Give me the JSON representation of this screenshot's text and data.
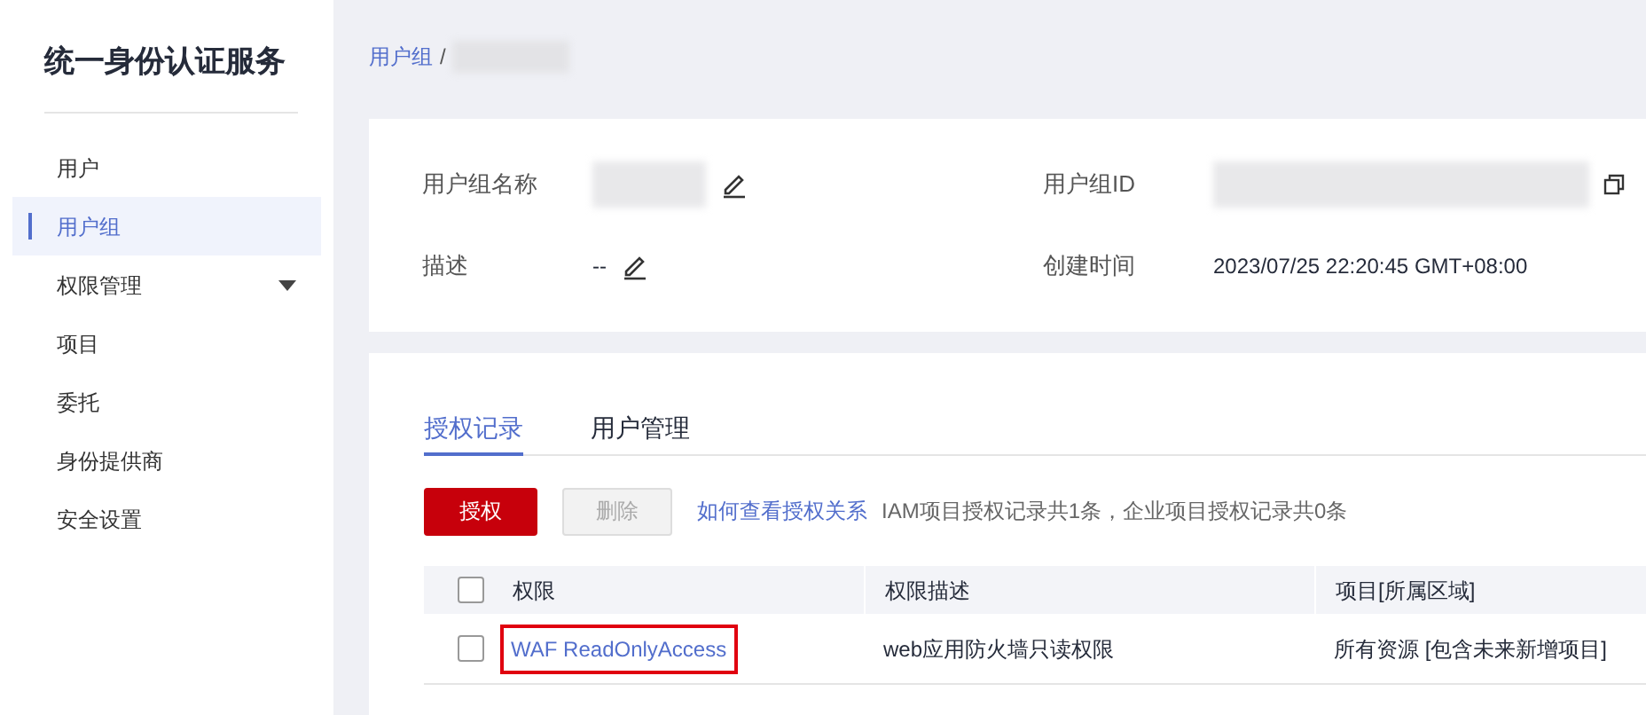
{
  "sidebar": {
    "title": "统一身份认证服务",
    "items": [
      {
        "label": "用户",
        "selected": false
      },
      {
        "label": "用户组",
        "selected": true
      },
      {
        "label": "权限管理",
        "selected": false,
        "expandable": true
      },
      {
        "label": "项目",
        "selected": false
      },
      {
        "label": "委托",
        "selected": false
      },
      {
        "label": "身份提供商",
        "selected": false
      },
      {
        "label": "安全设置",
        "selected": false
      }
    ]
  },
  "breadcrumb": {
    "parent": "用户组",
    "separator": "/"
  },
  "details": {
    "fields": [
      {
        "label": "用户组名称",
        "editable": true
      },
      {
        "label": "用户组ID",
        "copyable": true
      },
      {
        "label": "描述",
        "value": "--",
        "editable": true
      },
      {
        "label": "创建时间",
        "value": "2023/07/25 22:20:45 GMT+08:00"
      }
    ]
  },
  "tabs": [
    {
      "label": "授权记录",
      "selected": true
    },
    {
      "label": "用户管理",
      "selected": false
    }
  ],
  "toolbar": {
    "grant_button": "授权",
    "delete_button": {
      "label": "删除",
      "disabled": true
    },
    "help_link": "如何查看授权关系",
    "summary": "IAM项目授权记录共1条，企业项目授权记录共0条"
  },
  "table": {
    "all_checked": false,
    "columns": [
      "权限",
      "权限描述",
      "项目[所属区域]"
    ],
    "rows": [
      {
        "checked": false,
        "permission": "WAF ReadOnlyAccess",
        "highlighted": true,
        "description": "web应用防火墙只读权限",
        "scope": "所有资源 [包含未来新增项目]"
      }
    ]
  }
}
